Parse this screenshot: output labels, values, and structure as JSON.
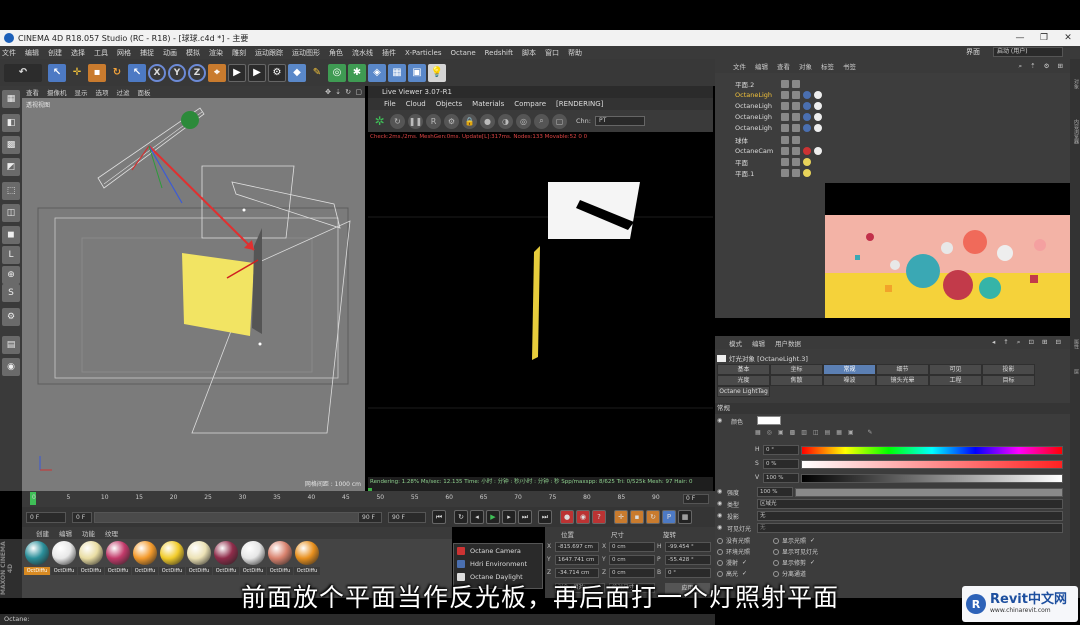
{
  "window": {
    "title": "CINEMA 4D R18.057 Studio (RC - R18) - [球球.c4d *] - 主要",
    "controls": [
      "—",
      "❐",
      "✕"
    ]
  },
  "menu": {
    "items": [
      "文件",
      "编辑",
      "创建",
      "选择",
      "工具",
      "网格",
      "捕捉",
      "动画",
      "模拟",
      "渲染",
      "雕刻",
      "运动跟踪",
      "运动图形",
      "角色",
      "流水线",
      "插件",
      "X-Particles",
      "Octane",
      "Redshift",
      "脚本",
      "窗口",
      "帮助"
    ],
    "layout_label": "界面",
    "layout_value": "启动 (用户)"
  },
  "toolbar": {
    "undo": "↶",
    "axis": [
      "X",
      "Y",
      "Z"
    ]
  },
  "viewport": {
    "menu": [
      "查看",
      "摄像机",
      "显示",
      "选项",
      "过滤",
      "面板"
    ],
    "label": "透视视图",
    "grid": "网格间距 : 1000 cm"
  },
  "live_viewer": {
    "title": "Live Viewer 3.07-R1",
    "menu": [
      "File",
      "Cloud",
      "Objects",
      "Materials",
      "Compare",
      "[RENDERING]"
    ],
    "channel_label": "Chn:",
    "channel_value": "PT",
    "status": "Check:2ms./2ms. MeshGen:0ms. Update[L]:317ms. Nodes:133 Movable:52 0 0",
    "render_stats": "Rendering: 1.28%   Ms/sec: 12.135   Time: 小时 : 分钟 : 秒/小时 : 分钟 : 秒   Spp/maxspp: 8/625   Tri: 0/525k   Mesh: 97   Hair: 0",
    "progress": 0.0128
  },
  "timeline": {
    "ticks": [
      "0",
      "5",
      "10",
      "15",
      "20",
      "25",
      "30",
      "35",
      "40",
      "45",
      "50",
      "55",
      "60",
      "65",
      "70",
      "75",
      "80",
      "85",
      "90"
    ],
    "current_frame": "0 F",
    "start": "0 F",
    "preview_start": "0 F",
    "preview_end": "90 F",
    "end": "90 F"
  },
  "materials": {
    "menu": [
      "创建",
      "编辑",
      "功能",
      "纹理"
    ],
    "items": [
      {
        "label": "OctDiffu",
        "color": "#2a8f9a",
        "active": true
      },
      {
        "label": "OctDiffu",
        "color": "#e8e8e8",
        "active": false
      },
      {
        "label": "OctDiffu",
        "color": "#e9dda3",
        "active": false
      },
      {
        "label": "OctDiffu",
        "color": "#c23a6a",
        "active": false
      },
      {
        "label": "OctDiffu",
        "color": "#f39a2b",
        "active": false
      },
      {
        "label": "OctDiffu",
        "color": "#f2cc2a",
        "active": false
      },
      {
        "label": "OctDiffu",
        "color": "#ece2b5",
        "active": false
      },
      {
        "label": "OctDiffu",
        "color": "#8f2c4a",
        "active": false
      },
      {
        "label": "OctDiffu",
        "color": "#e6e6e6",
        "active": false
      },
      {
        "label": "OctDiffu",
        "color": "#d9826e",
        "active": false
      },
      {
        "label": "OctDiffu",
        "color": "#e8901e",
        "active": false
      }
    ],
    "brand": "MAXON CINEMA 4D"
  },
  "octane_popup": {
    "items": [
      "Octane Camera",
      "Hdri Environment",
      "Octane Daylight"
    ]
  },
  "coords": {
    "headers": [
      "位置",
      "尺寸",
      "旋转"
    ],
    "rows": [
      {
        "axis": "X",
        "pos": "-815.697 cm",
        "size_axis": "X",
        "size": "0 cm",
        "rot_axis": "H",
        "rot": "-99.454 °"
      },
      {
        "axis": "Y",
        "pos": "1647.741 cm",
        "size_axis": "Y",
        "size": "0 cm",
        "rot_axis": "P",
        "rot": "-55.428 °"
      },
      {
        "axis": "Z",
        "pos": "-34.714 cm",
        "size_axis": "Z",
        "size": "0 cm",
        "rot_axis": "B",
        "rot": "0 °"
      }
    ],
    "mode": "对象 (相对)",
    "size_mode": "绝对尺寸",
    "apply": "应用"
  },
  "object_manager": {
    "menu": [
      "文件",
      "编辑",
      "查看",
      "对象",
      "标签",
      "书签"
    ],
    "objects": [
      "平面.2",
      "OctaneLigh",
      "OctaneLigh",
      "OctaneLigh",
      "OctaneLigh",
      "球体",
      "OctaneCam",
      "平面",
      "平面.1"
    ]
  },
  "attributes": {
    "menu": [
      "模式",
      "编辑",
      "用户数据"
    ],
    "object_label": "灯光对象 [OctaneLight.3]",
    "tabs": [
      "基本",
      "坐标",
      "常规",
      "细节",
      "可见",
      "投影",
      "光度",
      "焦散",
      "噪波",
      "镜头光晕",
      "工程",
      "目标"
    ],
    "tag_label": "Octane LightTag",
    "section": "常规",
    "color_label": "颜色",
    "h_label": "H",
    "h_value": "0 °",
    "s_label": "S",
    "s_value": "0 %",
    "v_label": "V",
    "v_value": "100 %",
    "intensity_label": "强度",
    "intensity_value": "100 %",
    "type_label": "类型",
    "type_value": "区域光",
    "shadow_label": "投影",
    "shadow_value": "无",
    "visible_label": "可见灯光",
    "visible_value": "无",
    "checks": [
      {
        "label": "没有光照",
        "checked": false
      },
      {
        "label": "显示光照",
        "checked": true
      },
      {
        "label": "环境光照",
        "checked": false
      },
      {
        "label": "显示可见灯光",
        "checked": false
      },
      {
        "label": "漫射",
        "checked": true
      },
      {
        "label": "显示修剪",
        "checked": true
      },
      {
        "label": "高光",
        "checked": true
      },
      {
        "label": "分离通道",
        "checked": false
      }
    ]
  },
  "status": "Octane:",
  "subtitle": "前面放个平面当作反光板，再后面打一个灯照射平面",
  "watermark": {
    "logo": "R",
    "name": "Revit中文网",
    "url": "www.chinarevit.com"
  }
}
